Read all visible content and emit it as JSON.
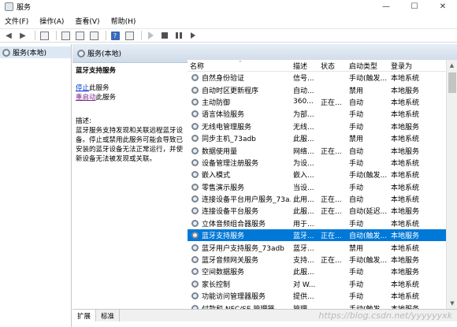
{
  "window": {
    "title": "服务",
    "buttons": [
      "—",
      "☐",
      "✕"
    ]
  },
  "menu": [
    "文件(F)",
    "操作(A)",
    "查看(V)",
    "帮助(H)"
  ],
  "tree": {
    "item": "服务(本地)"
  },
  "panel": {
    "header": "服务(本地)"
  },
  "description": {
    "title": "蓝牙支持服务",
    "stop_link": "停止",
    "stop_suffix": "此服务",
    "restart_link": "重启动",
    "restart_suffix": "此服务",
    "label": "描述:",
    "text": "蓝牙服务支持发现和关联远程蓝牙设备。停止或禁用此服务可能会导致已安装的蓝牙设备无法正常运行，并使新设备无法被发现或关联。"
  },
  "columns": {
    "name": "名称",
    "desc": "描述",
    "status": "状态",
    "start": "启动类型",
    "logon": "登录为"
  },
  "rows": [
    {
      "name": "自然身份验证",
      "desc": "信号...",
      "status": "",
      "start": "手动(触发...",
      "logon": "本地系统"
    },
    {
      "name": "自动时区更新程序",
      "desc": "自动...",
      "status": "",
      "start": "禁用",
      "logon": "本地服务"
    },
    {
      "name": "主动防御",
      "desc": "360...",
      "status": "正在...",
      "start": "自动",
      "logon": "本地系统"
    },
    {
      "name": "语言体验服务",
      "desc": "为部...",
      "status": "",
      "start": "手动",
      "logon": "本地系统"
    },
    {
      "name": "无线电管理服务",
      "desc": "无线...",
      "status": "",
      "start": "手动",
      "logon": "本地服务"
    },
    {
      "name": "同步主机_73adb",
      "desc": "此服...",
      "status": "",
      "start": "禁用",
      "logon": "本地系统"
    },
    {
      "name": "数据使用量",
      "desc": "网络...",
      "status": "正在...",
      "start": "自动",
      "logon": "本地服务"
    },
    {
      "name": "设备管理注册服务",
      "desc": "为设...",
      "status": "",
      "start": "手动",
      "logon": "本地系统"
    },
    {
      "name": "嵌入模式",
      "desc": "嵌入...",
      "status": "",
      "start": "手动(触发...",
      "logon": "本地系统"
    },
    {
      "name": "零售演示服务",
      "desc": "当设...",
      "status": "",
      "start": "手动",
      "logon": "本地系统"
    },
    {
      "name": "连接设备平台用户服务_73a...",
      "desc": "此用...",
      "status": "正在...",
      "start": "自动",
      "logon": "本地系统"
    },
    {
      "name": "连接设备平台服务",
      "desc": "此服...",
      "status": "正在...",
      "start": "自动(延迟...",
      "logon": "本地服务"
    },
    {
      "name": "立体音频组合器服务",
      "desc": "用于...",
      "status": "",
      "start": "手动",
      "logon": "本地系统"
    },
    {
      "name": "蓝牙支持服务",
      "desc": "蓝牙...",
      "status": "正在...",
      "start": "自动(触发...",
      "logon": "本地服务"
    },
    {
      "name": "蓝牙用户支持服务_73adb",
      "desc": "蓝牙...",
      "status": "",
      "start": "禁用",
      "logon": "本地系统"
    },
    {
      "name": "蓝牙音频网关服务",
      "desc": "支持...",
      "status": "正在...",
      "start": "手动(触发...",
      "logon": "本地服务"
    },
    {
      "name": "空间数据服务",
      "desc": "此服...",
      "status": "",
      "start": "手动",
      "logon": "本地服务"
    },
    {
      "name": "家长控制",
      "desc": "对 W...",
      "status": "",
      "start": "手动",
      "logon": "本地系统"
    },
    {
      "name": "功能访问管理器服务",
      "desc": "提供...",
      "status": "",
      "start": "手动",
      "logon": "本地系统"
    },
    {
      "name": "付款和 NFC/SE 管理器",
      "desc": "管理...",
      "status": "",
      "start": "手动(触发...",
      "logon": "本地服务"
    }
  ],
  "tabs": [
    "扩展",
    "标准"
  ],
  "watermark": "https://blog.csdn.net/yyyyyyxk"
}
